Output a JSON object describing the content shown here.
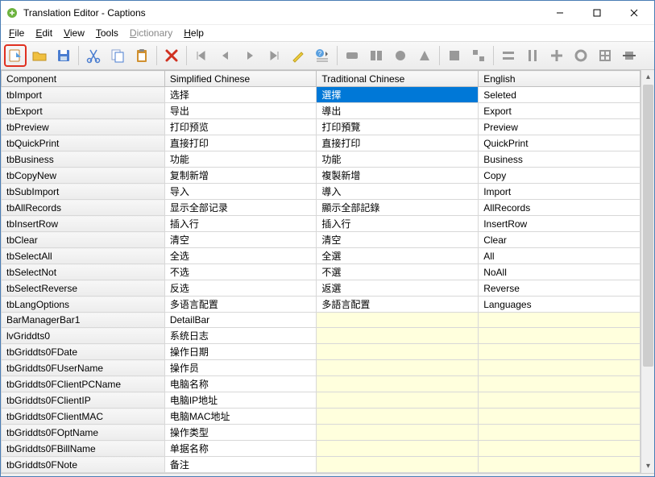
{
  "window": {
    "title": "Translation Editor - Captions"
  },
  "menu": {
    "file": "File",
    "edit": "Edit",
    "view": "View",
    "tools": "Tools",
    "dictionary": "Dictionary",
    "help": "Help"
  },
  "columns": {
    "component": "Component",
    "simplified": "Simplified Chinese",
    "traditional": "Traditional Chinese",
    "english": "English"
  },
  "selected_row": 0,
  "selected_col": "traditional",
  "rows": [
    {
      "component": "tbImport",
      "simplified": "选择",
      "traditional": "選擇",
      "english": "Seleted"
    },
    {
      "component": "tbExport",
      "simplified": "导出",
      "traditional": "導出",
      "english": "Export"
    },
    {
      "component": "tbPreview",
      "simplified": "打印预览",
      "traditional": "打印預覽",
      "english": "Preview"
    },
    {
      "component": "tbQuickPrint",
      "simplified": "直接打印",
      "traditional": "直接打印",
      "english": "QuickPrint"
    },
    {
      "component": "tbBusiness",
      "simplified": "功能",
      "traditional": "功能",
      "english": "Business"
    },
    {
      "component": "tbCopyNew",
      "simplified": "复制新增",
      "traditional": "複製新增",
      "english": "Copy"
    },
    {
      "component": "tbSubImport",
      "simplified": "导入",
      "traditional": "導入",
      "english": "Import"
    },
    {
      "component": "tbAllRecords",
      "simplified": "显示全部记录",
      "traditional": "顯示全部記錄",
      "english": "AllRecords"
    },
    {
      "component": "tbInsertRow",
      "simplified": "插入行",
      "traditional": "插入行",
      "english": "InsertRow"
    },
    {
      "component": "tbClear",
      "simplified": "清空",
      "traditional": "清空",
      "english": "Clear"
    },
    {
      "component": "tbSelectAll",
      "simplified": "全选",
      "traditional": "全選",
      "english": "All"
    },
    {
      "component": "tbSelectNot",
      "simplified": "不选",
      "traditional": "不選",
      "english": "NoAll"
    },
    {
      "component": "tbSelectReverse",
      "simplified": "反选",
      "traditional": "返選",
      "english": "Reverse"
    },
    {
      "component": "tbLangOptions",
      "simplified": "多语言配置",
      "traditional": "多語言配置",
      "english": "Languages"
    },
    {
      "component": "BarManagerBar1",
      "simplified": "DetailBar",
      "traditional": "",
      "english": "",
      "empty": true
    },
    {
      "component": "lvGriddts0",
      "simplified": "系统日志",
      "traditional": "",
      "english": "",
      "empty": true
    },
    {
      "component": "tbGriddts0FDate",
      "simplified": "操作日期",
      "traditional": "",
      "english": "",
      "empty": true
    },
    {
      "component": "tbGriddts0FUserName",
      "simplified": "操作员",
      "traditional": "",
      "english": "",
      "empty": true
    },
    {
      "component": "tbGriddts0FClientPCName",
      "simplified": "电脑名称",
      "traditional": "",
      "english": "",
      "empty": true
    },
    {
      "component": "tbGriddts0FClientIP",
      "simplified": "电脑IP地址",
      "traditional": "",
      "english": "",
      "empty": true
    },
    {
      "component": "tbGriddts0FClientMAC",
      "simplified": "电脑MAC地址",
      "traditional": "",
      "english": "",
      "empty": true
    },
    {
      "component": "tbGriddts0FOptName",
      "simplified": "操作类型",
      "traditional": "",
      "english": "",
      "empty": true
    },
    {
      "component": "tbGriddts0FBillName",
      "simplified": "单据名称",
      "traditional": "",
      "english": "",
      "empty": true
    },
    {
      "component": "tbGriddts0FNote",
      "simplified": "备注",
      "traditional": "",
      "english": "",
      "empty": true
    }
  ]
}
